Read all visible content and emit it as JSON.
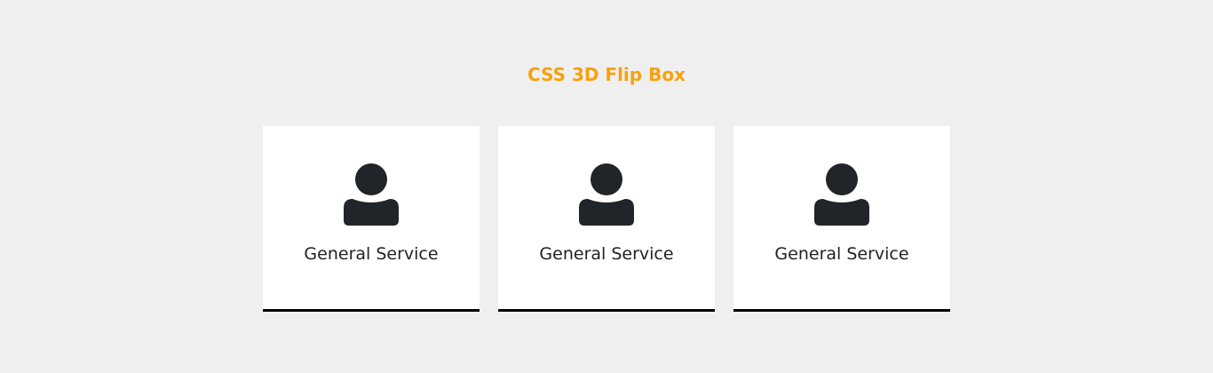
{
  "title": "CSS 3D Flip Box",
  "accent_color": "#f7a10c",
  "cards": [
    {
      "icon": "user-icon",
      "label": "General Service"
    },
    {
      "icon": "user-icon",
      "label": "General Service"
    },
    {
      "icon": "user-icon",
      "label": "General Service"
    }
  ]
}
